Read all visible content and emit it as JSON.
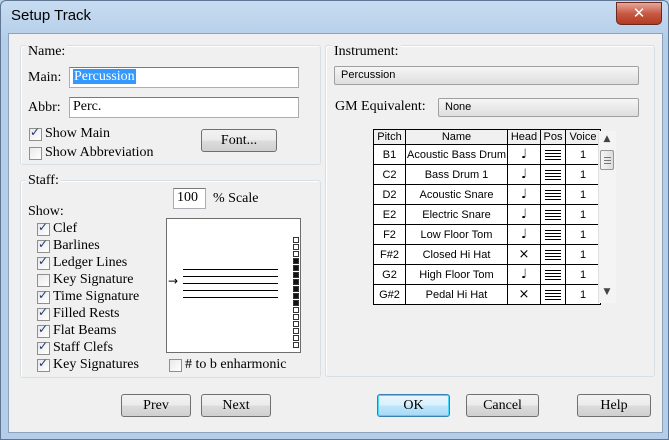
{
  "window": {
    "title": "Setup Track",
    "close_glyph": "✕"
  },
  "name_group": {
    "label": "Name:",
    "main_label": "Main:",
    "main_value": "Percussion",
    "abbr_label": "Abbr:",
    "abbr_value": "Perc.",
    "show_main": {
      "label": "Show Main",
      "checked": true
    },
    "show_abbr": {
      "label": "Show Abbreviation",
      "checked": false
    },
    "font_button": "Font..."
  },
  "staff_group": {
    "label": "Staff:",
    "scale_value": "100",
    "scale_label": "% Scale",
    "show_label": "Show:",
    "options": [
      {
        "label": "Clef",
        "checked": true
      },
      {
        "label": "Barlines",
        "checked": true
      },
      {
        "label": "Ledger Lines",
        "checked": true
      },
      {
        "label": "Key Signature",
        "checked": false
      },
      {
        "label": "Time Signature",
        "checked": true
      },
      {
        "label": "Filled Rests",
        "checked": true
      },
      {
        "label": "Flat Beams",
        "checked": true
      },
      {
        "label": "Staff Clefs",
        "checked": true
      },
      {
        "label": "Key Signatures",
        "checked": true
      }
    ],
    "enharmonic": {
      "label": "# to b enharmonic",
      "checked": false
    },
    "arrow_glyph": "→"
  },
  "instrument_group": {
    "label": "Instrument:",
    "instrument_value": "Percussion",
    "gm_label": "GM Equivalent:",
    "gm_value": "None"
  },
  "kit_table": {
    "headers": [
      "Pitch",
      "Name",
      "Head",
      "Pos",
      "Voice"
    ],
    "rows": [
      {
        "pitch": "B1",
        "name": "Acoustic Bass Drum",
        "head": "♩",
        "voice": "1"
      },
      {
        "pitch": "C2",
        "name": "Bass Drum 1",
        "head": "♩",
        "voice": "1"
      },
      {
        "pitch": "D2",
        "name": "Acoustic Snare",
        "head": "♩",
        "voice": "1"
      },
      {
        "pitch": "E2",
        "name": "Electric Snare",
        "head": "♩",
        "voice": "1"
      },
      {
        "pitch": "F2",
        "name": "Low Floor Tom",
        "head": "♩",
        "voice": "1"
      },
      {
        "pitch": "F#2",
        "name": "Closed Hi Hat",
        "head": "×",
        "voice": "1"
      },
      {
        "pitch": "G2",
        "name": "High Floor Tom",
        "head": "♩",
        "voice": "1"
      },
      {
        "pitch": "G#2",
        "name": "Pedal Hi Hat",
        "head": "×",
        "voice": "1"
      }
    ],
    "scroll_up": "▲",
    "scroll_down": "▼"
  },
  "buttons": {
    "prev": "Prev",
    "next": "Next",
    "ok": "OK",
    "cancel": "Cancel",
    "help": "Help"
  }
}
